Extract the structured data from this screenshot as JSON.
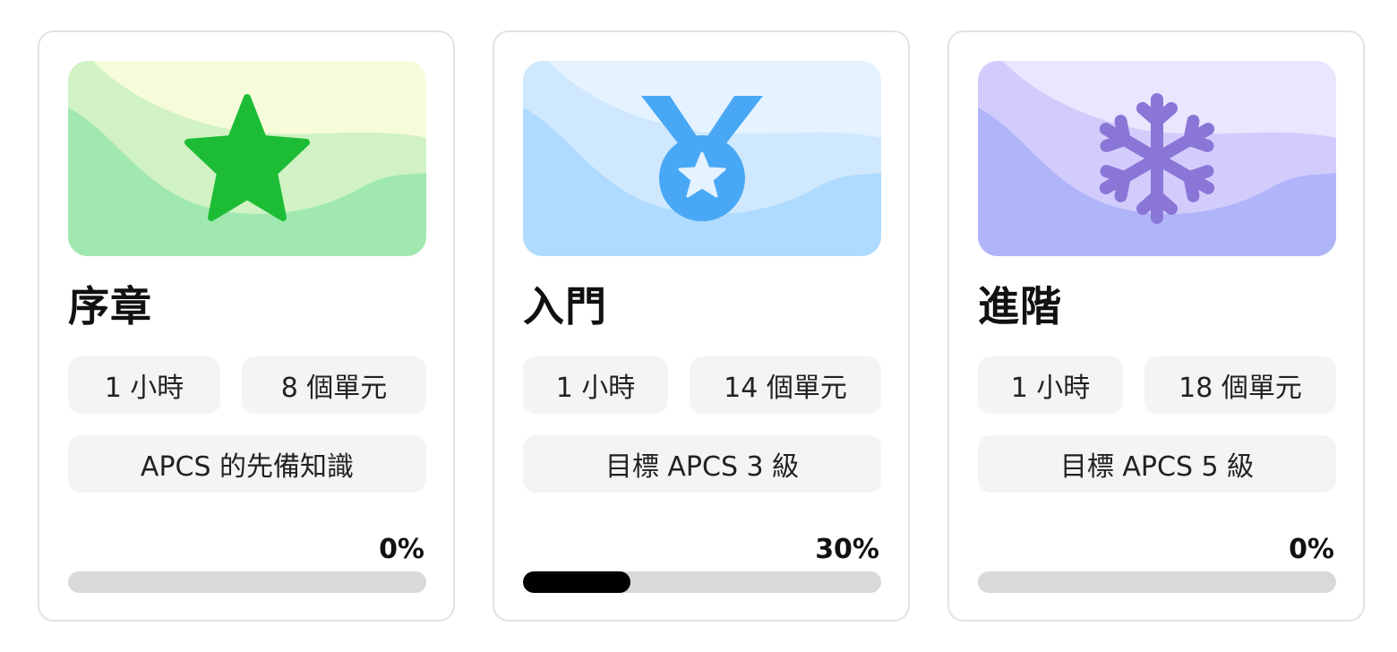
{
  "courses": [
    {
      "title": "序章",
      "duration": "1 小時",
      "units": "8 個單元",
      "goal": "APCS 的先備知識",
      "progress_label": "0%",
      "progress": 0,
      "icon": "star-icon",
      "colors": {
        "sky": "#f6fcda",
        "mid": "#d1f2c4",
        "front": "#a0e8b0",
        "icon": "#1cbd35"
      }
    },
    {
      "title": "入門",
      "duration": "1 小時",
      "units": "14 個單元",
      "goal": "目標 APCS 3 級",
      "progress_label": "30%",
      "progress": 0.3,
      "icon": "medal-icon",
      "colors": {
        "sky": "#e5f2ff",
        "mid": "#cfe8fd",
        "front": "#aedbff",
        "icon": "#49a8f5"
      }
    },
    {
      "title": "進階",
      "duration": "1 小時",
      "units": "18 個單元",
      "goal": "目標 APCS 5 級",
      "progress_label": "0%",
      "progress": 0,
      "icon": "snowflake-icon",
      "colors": {
        "sky": "#e9e6ff",
        "mid": "#d2ccfd",
        "front": "#b0b4f9",
        "icon": "#8a76d6"
      }
    }
  ]
}
